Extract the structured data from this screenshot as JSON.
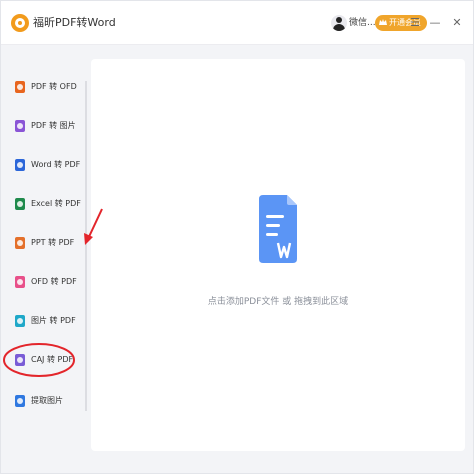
{
  "window": {
    "app_title": "福昕PDF转Word",
    "username": "微信...",
    "vip_label": "开通会员",
    "menu_icon": "☰",
    "minimize_icon": "—",
    "close_icon": "✕"
  },
  "sidebar": {
    "items": [
      {
        "label": "PDF 转 OFD",
        "color": "#e8651f"
      },
      {
        "label": "PDF 转 图片",
        "color": "#8a55d6"
      },
      {
        "label": "Word 转 PDF",
        "color": "#2b66d9"
      },
      {
        "label": "Excel 转 PDF",
        "color": "#1f8a4c"
      },
      {
        "label": "PPT 转 PDF",
        "color": "#e4702b"
      },
      {
        "label": "OFD 转 PDF",
        "color": "#e8508a"
      },
      {
        "label": "图片 转 PDF",
        "color": "#1fa8c9"
      },
      {
        "label": "CAJ 转 PDF",
        "color": "#7a5cd6"
      },
      {
        "label": "提取图片",
        "color": "#2f78e0"
      }
    ]
  },
  "main": {
    "drop_hint": "点击添加PDF文件 或 拖拽到此区域"
  },
  "colors": {
    "accent_orange": "#f0a52b",
    "annotation_red": "#e3252b",
    "doc_blue": "#4a8af4"
  }
}
